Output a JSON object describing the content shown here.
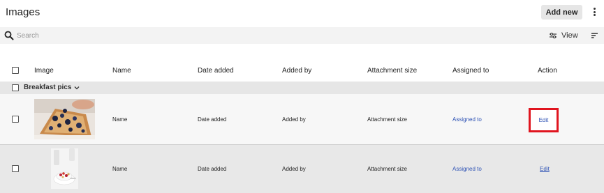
{
  "header": {
    "title": "Images",
    "add_button": "Add new"
  },
  "toolbar": {
    "search_placeholder": "Search",
    "view_label": "View"
  },
  "table": {
    "columns": [
      "Image",
      "Name",
      "Date added",
      "Added by",
      "Attachment size",
      "Assigned to",
      "Action"
    ],
    "group": {
      "label": "Breakfast pics"
    },
    "rows": [
      {
        "name": "Name",
        "date_added": "Date added",
        "added_by": "Added by",
        "attachment_size": "Attachment size",
        "assigned_to": "Assigned to",
        "action": "Edit"
      },
      {
        "name": "Name",
        "date_added": "Date added",
        "added_by": "Added by",
        "attachment_size": "Attachment size",
        "assigned_to": "Assigned to",
        "action": "Edit"
      }
    ]
  },
  "icons": {
    "search": "search-icon",
    "view": "sliders-icon",
    "sort": "sort-icon",
    "more": "kebab-menu-icon",
    "expand": "chevron-down-icon"
  },
  "colors": {
    "link": "#2f53b5",
    "highlight": "#e0151f"
  }
}
